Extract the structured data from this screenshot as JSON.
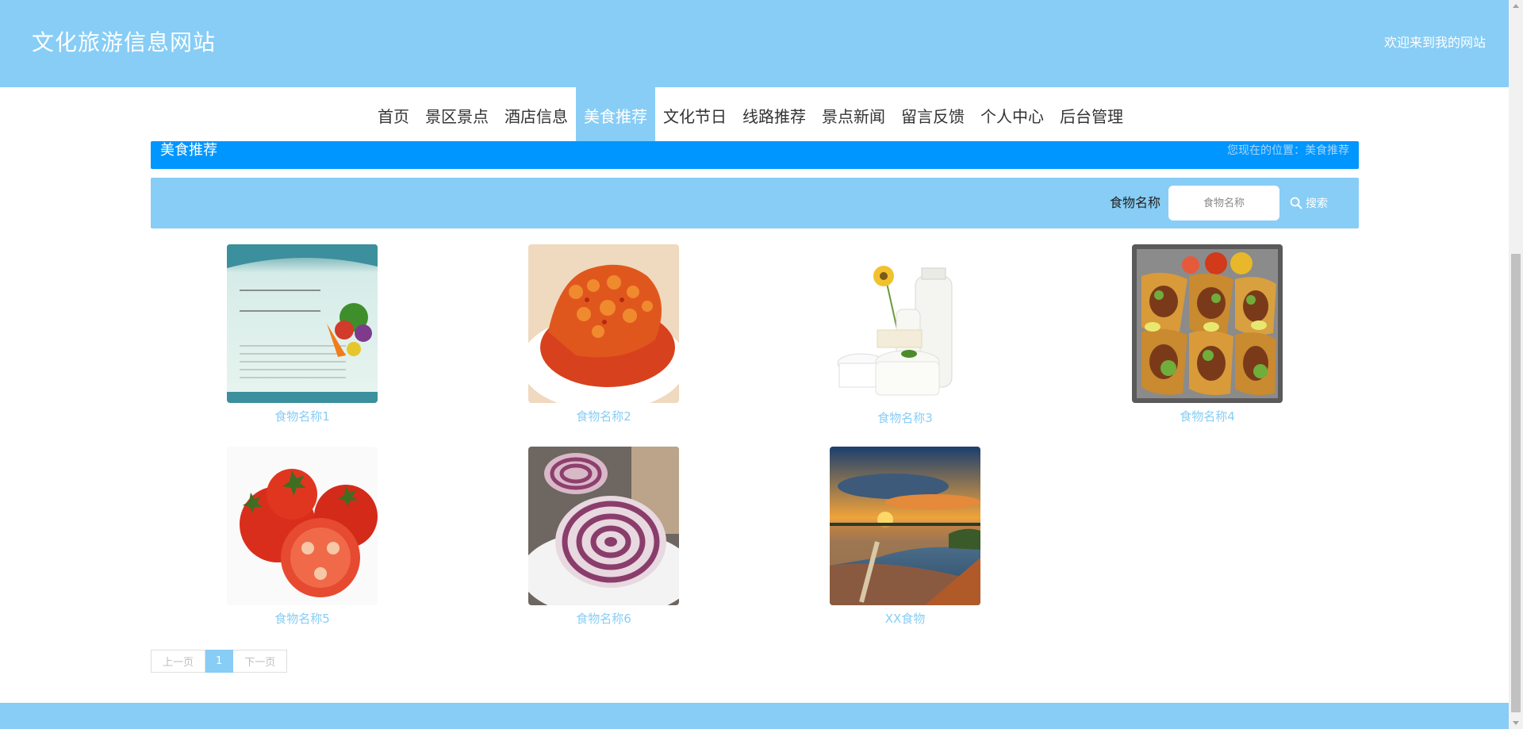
{
  "header": {
    "site_title": "文化旅游信息网站",
    "welcome": "欢迎来到我的网站"
  },
  "nav": {
    "items": [
      {
        "label": "首页",
        "active": false
      },
      {
        "label": "景区景点",
        "active": false
      },
      {
        "label": "酒店信息",
        "active": false
      },
      {
        "label": "美食推荐",
        "active": true
      },
      {
        "label": "文化节日",
        "active": false
      },
      {
        "label": "线路推荐",
        "active": false
      },
      {
        "label": "景点新闻",
        "active": false
      },
      {
        "label": "留言反馈",
        "active": false
      },
      {
        "label": "个人中心",
        "active": false
      },
      {
        "label": "后台管理",
        "active": false
      }
    ]
  },
  "breadcrumb": {
    "title": "美食推荐",
    "position": "您现在的位置：美食推荐"
  },
  "search": {
    "label": "食物名称",
    "placeholder": "食物名称",
    "value": "",
    "button_label": "搜索",
    "button_icon": "search-icon"
  },
  "foods": [
    {
      "name": "食物名称1",
      "image": "nutrition-poster"
    },
    {
      "name": "食物名称2",
      "image": "sweet-sour-fish"
    },
    {
      "name": "食物名称3",
      "image": "milk-and-cheese"
    },
    {
      "name": "食物名称4",
      "image": "tacos-tray"
    },
    {
      "name": "食物名称5",
      "image": "tomatoes"
    },
    {
      "name": "食物名称6",
      "image": "purple-swirl-buns"
    },
    {
      "name": "XX食物",
      "image": "sunset-lake"
    }
  ],
  "pagination": {
    "prev": "上一页",
    "current": "1",
    "next": "下一页"
  },
  "colors": {
    "primary": "#87cdf6",
    "breadcrumb": "#0096ff",
    "link": "#87cdf6"
  }
}
